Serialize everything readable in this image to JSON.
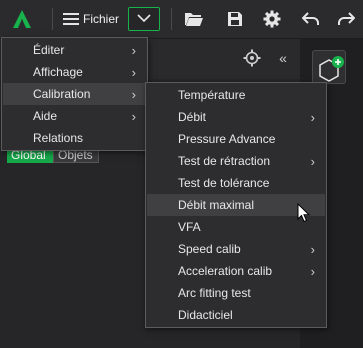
{
  "toolbar": {
    "file_label": "Fichier"
  },
  "panel": {
    "segments": [
      "Global",
      "Objets"
    ]
  },
  "main_menu": {
    "items": [
      {
        "label": "Éditer",
        "has_submenu": true
      },
      {
        "label": "Affichage",
        "has_submenu": true
      },
      {
        "label": "Calibration",
        "has_submenu": true
      },
      {
        "label": "Aide",
        "has_submenu": true
      },
      {
        "label": "Relations",
        "has_submenu": false
      }
    ]
  },
  "calibration_menu": {
    "items": [
      {
        "label": "Température",
        "has_submenu": false
      },
      {
        "label": "Débit",
        "has_submenu": true
      },
      {
        "label": "Pressure Advance",
        "has_submenu": false
      },
      {
        "label": "Test de rétraction",
        "has_submenu": true
      },
      {
        "label": "Test de tolérance",
        "has_submenu": false
      },
      {
        "label": "Débit maximal",
        "has_submenu": false
      },
      {
        "label": "VFA",
        "has_submenu": false
      },
      {
        "label": "Speed calib",
        "has_submenu": true
      },
      {
        "label": "Acceleration calib",
        "has_submenu": true
      },
      {
        "label": "Arc fitting test",
        "has_submenu": false
      },
      {
        "label": "Didacticiel",
        "has_submenu": false
      }
    ]
  },
  "colors": {
    "accent": "#19b34d",
    "background": "#262628",
    "menu_bg": "#2d2d2f",
    "menu_highlight": "#404043"
  },
  "icons": [
    "app-logo-icon",
    "hamburger-icon",
    "chevron-down-icon",
    "folder-open-icon",
    "save-icon",
    "gear-icon",
    "undo-icon",
    "redo-icon",
    "settings-icon",
    "collapse-icon",
    "add-object-icon",
    "mouse-cursor-icon"
  ]
}
